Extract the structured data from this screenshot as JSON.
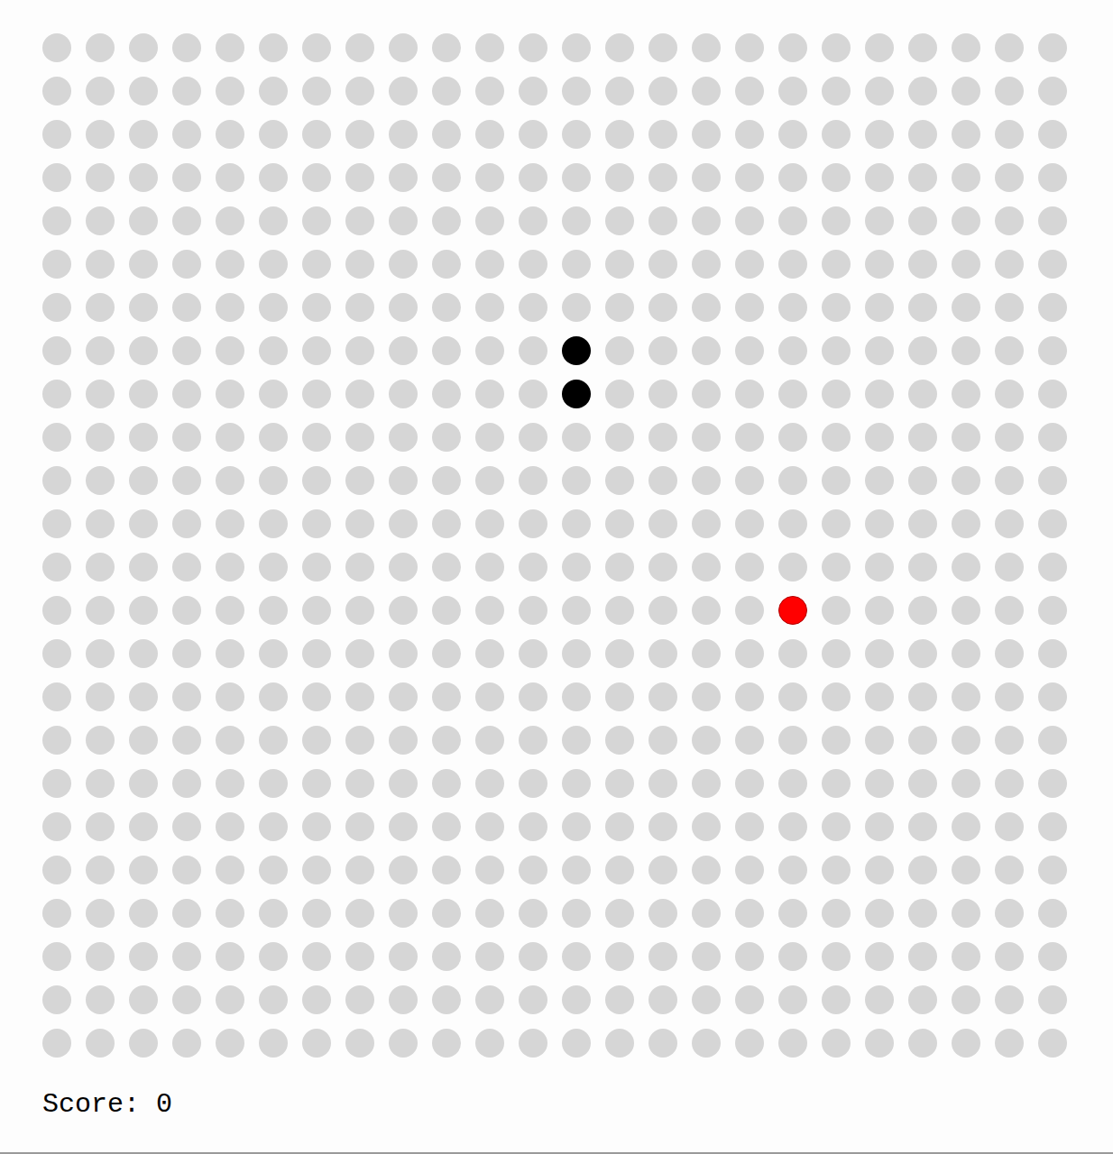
{
  "board": {
    "columns": 24,
    "rows": 24
  },
  "snake": [
    {
      "row": 7,
      "col": 12
    },
    {
      "row": 8,
      "col": 12
    }
  ],
  "food": {
    "row": 13,
    "col": 17
  },
  "score": {
    "label": "Score:",
    "value": "0"
  }
}
